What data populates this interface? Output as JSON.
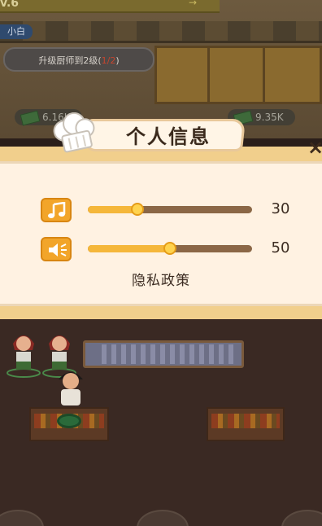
{
  "hud": {
    "level_text": "v.6",
    "level_arrows": "→",
    "rank_label": "小白",
    "task": {
      "text_prefix": "升级厨师到2级(",
      "progress": "1/2",
      "text_suffix": ")"
    },
    "money_left": "6.16K",
    "money_right": "9.35K"
  },
  "dialog": {
    "title": "个人信息",
    "close_label": "×",
    "settings": [
      {
        "name": "music",
        "icon": "music-note-icon",
        "value": 30,
        "value_label": "30"
      },
      {
        "name": "sound",
        "icon": "speaker-icon",
        "value": 50,
        "value_label": "50"
      }
    ],
    "privacy_label": "隐私政策"
  },
  "colors": {
    "panel_bg": "#fff2e2",
    "panel_frame": "#f1cf8c",
    "icon_orange": "#f2a52a",
    "slider_track": "#8b6746",
    "slider_fill": "#f5b73a",
    "progress_red": "#c4452f"
  }
}
